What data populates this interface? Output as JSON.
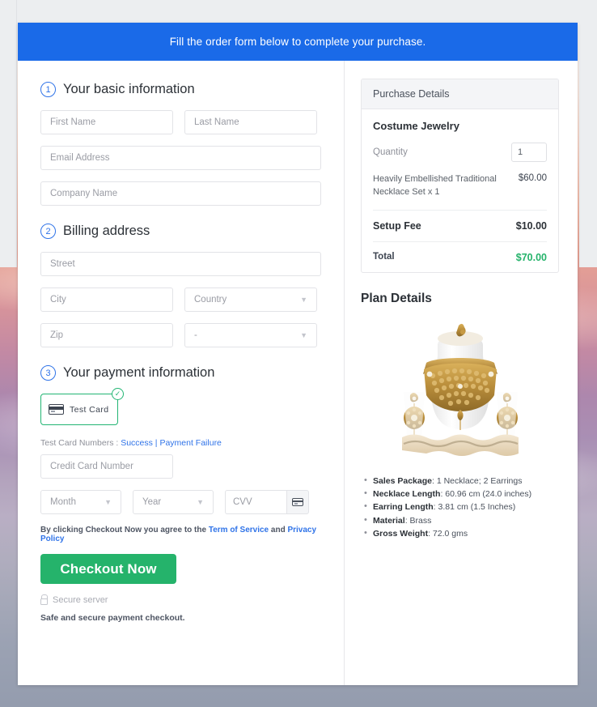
{
  "banner": {
    "text": "Fill the order form below to complete your purchase."
  },
  "form": {
    "step1": {
      "number": "1",
      "title": "Your basic information",
      "first_name_placeholder": "First Name",
      "last_name_placeholder": "Last Name",
      "email_placeholder": "Email Address",
      "company_placeholder": "Company Name"
    },
    "step2": {
      "number": "2",
      "title": "Billing address",
      "street_placeholder": "Street",
      "city_placeholder": "City",
      "country_placeholder": "Country",
      "zip_placeholder": "Zip",
      "state_placeholder": "-"
    },
    "step3": {
      "number": "3",
      "title": "Your payment information",
      "card_tile_label": "Test  Card",
      "card_tile_check": "✓",
      "test_numbers_label": "Test Card Numbers : ",
      "test_success_link": "Success",
      "test_separator": " | ",
      "test_failure_link": "Payment Failure",
      "card_number_placeholder": "Credit Card Number",
      "month_placeholder": "Month",
      "year_placeholder": "Year",
      "cvv_placeholder": "CVV"
    },
    "terms": {
      "prefix": "By clicking Checkout Now you agree to the ",
      "tos_link": "Term of Service",
      "middle": " and ",
      "privacy_link": "Privacy Policy"
    },
    "checkout_button": "Checkout Now",
    "secure_server": "Secure server",
    "safe_note": "Safe and secure payment checkout."
  },
  "purchase": {
    "header": "Purchase Details",
    "product_name": "Costume Jewelry",
    "quantity_label": "Quantity",
    "quantity_value": "1",
    "line_item_desc": "Heavily Embellished Traditional Necklace Set x 1",
    "line_item_price": "$60.00",
    "setup_fee_label": "Setup Fee",
    "setup_fee_price": "$10.00",
    "total_label": "Total",
    "total_price": "$70.00"
  },
  "plan": {
    "title": "Plan Details",
    "specs": [
      {
        "label": "Sales Package",
        "value": ": 1 Necklace; 2 Earrings"
      },
      {
        "label": "Necklace Length",
        "value": ": 60.96 cm (24.0 inches)"
      },
      {
        "label": "Earring Length",
        "value": ": 3.81 cm (1.5 Inches)"
      },
      {
        "label": "Material",
        "value": ": Brass"
      },
      {
        "label": "Gross Weight",
        "value": ": 72.0 gms"
      }
    ]
  },
  "colors": {
    "banner_blue": "#1a6ae8",
    "accent_blue": "#2f73e8",
    "success_green": "#25b36b",
    "tile_green": "#22b573"
  }
}
